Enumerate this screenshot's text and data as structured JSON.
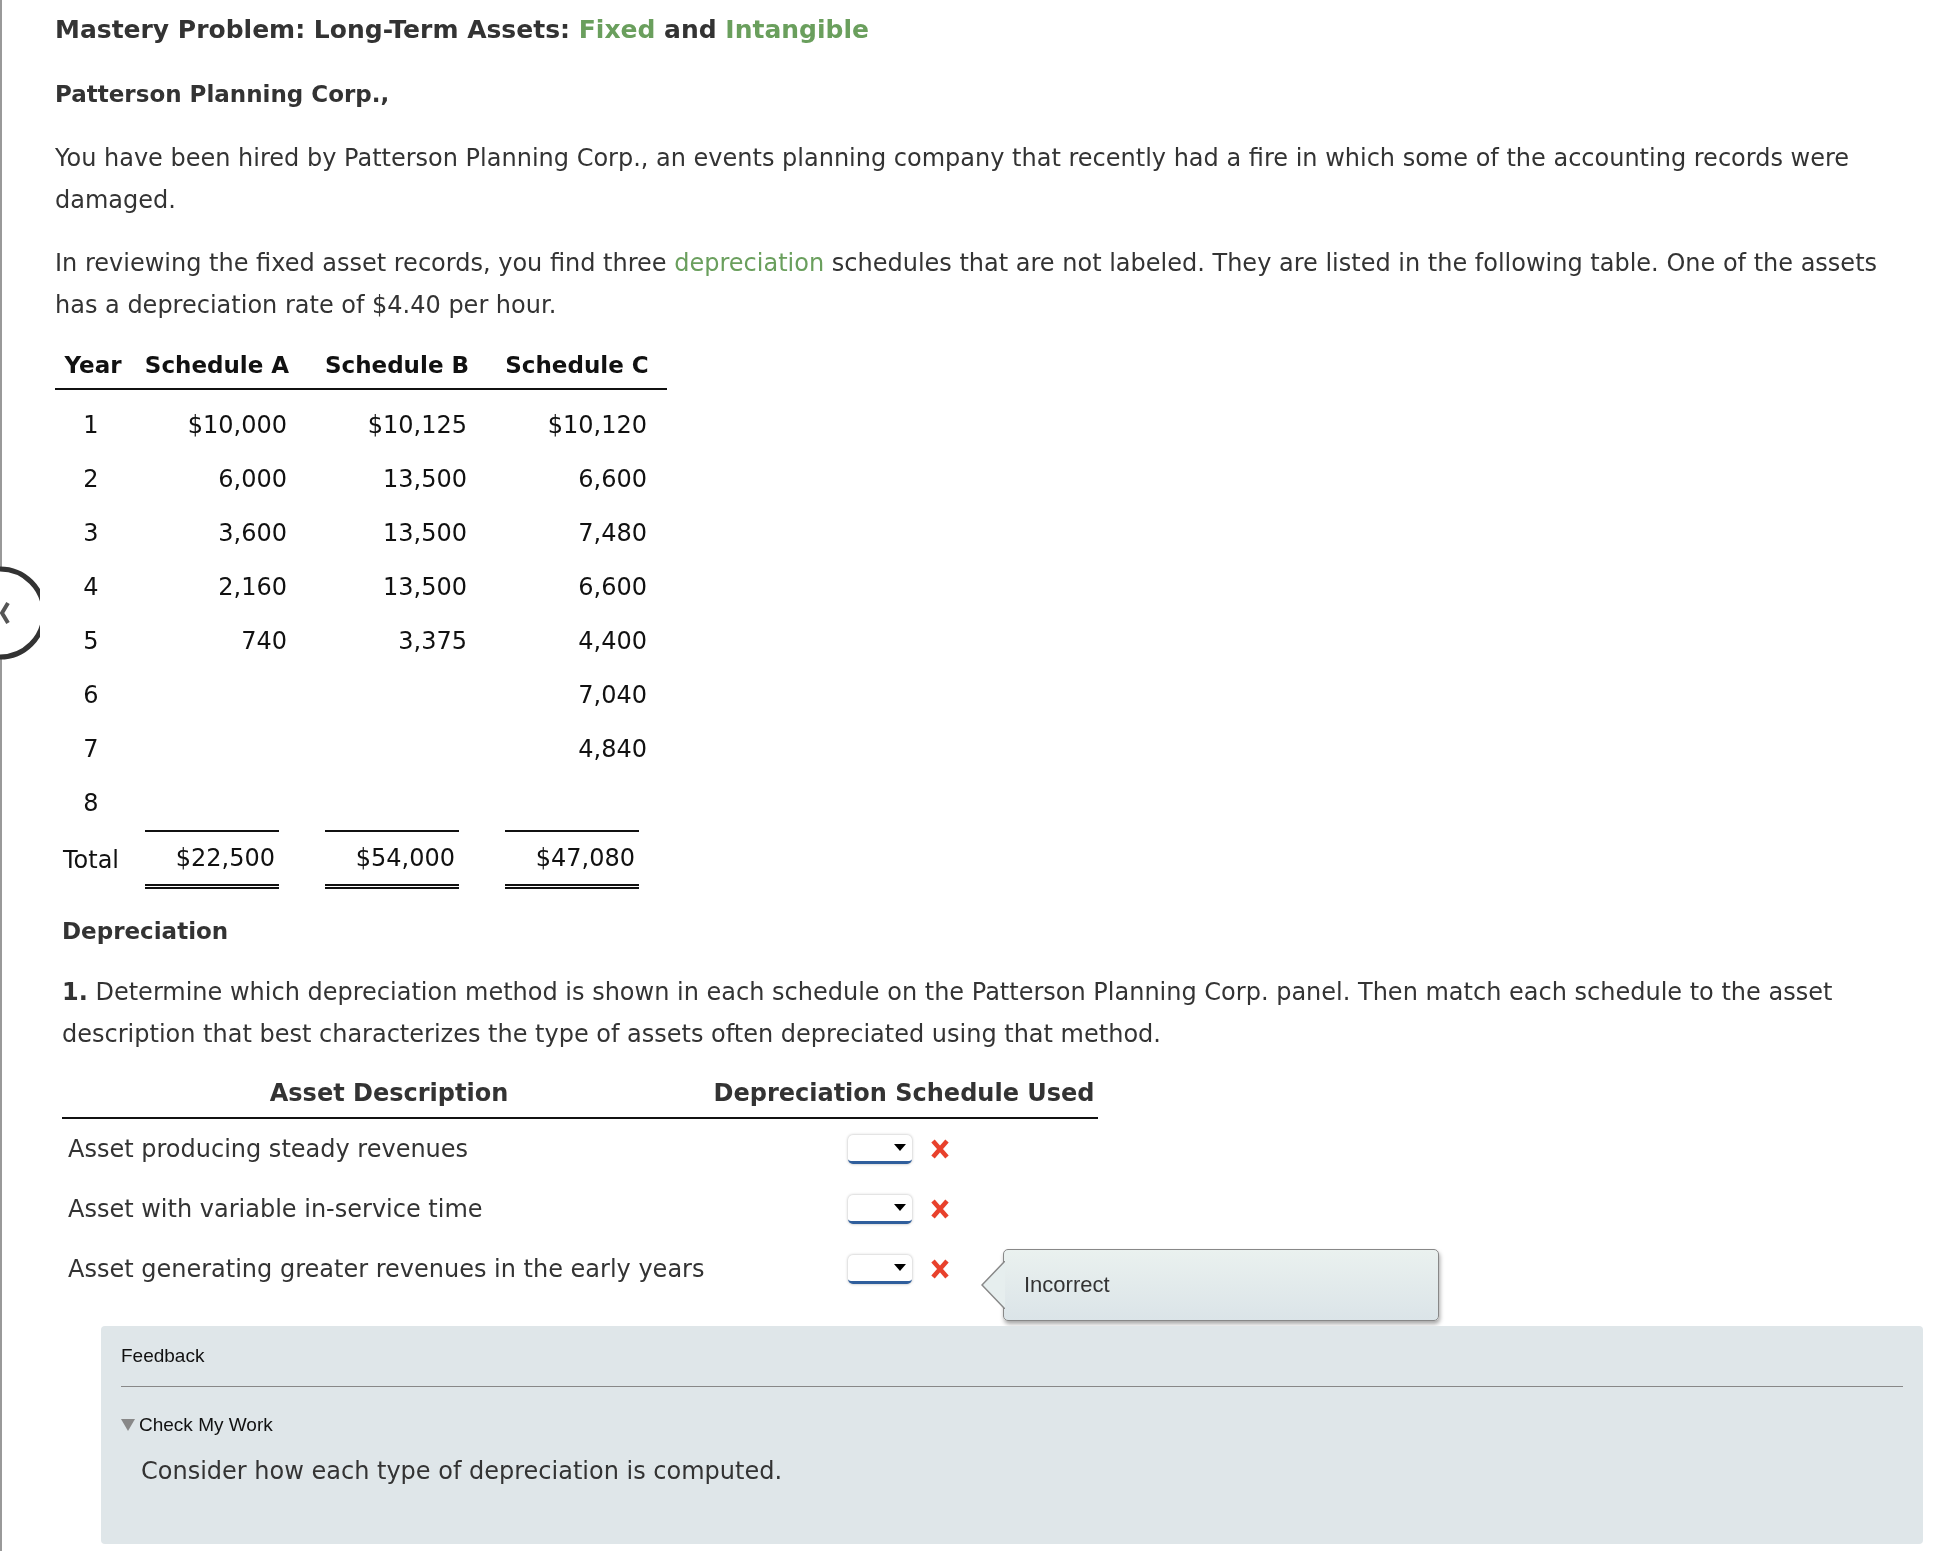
{
  "title": [
    {
      "kind": "plain",
      "text": "Mastery Problem: Long-Term Assets: "
    },
    {
      "kind": "link",
      "text": "Fixed"
    },
    {
      "kind": "plain",
      "text": " and "
    },
    {
      "kind": "link",
      "text": "Intangible"
    }
  ],
  "company": "Patterson Planning Corp.,",
  "paragraphs": [
    [
      {
        "kind": "plain",
        "text": "You have been hired by Patterson Planning Corp., an events planning company that recently had a fire in which some of the accounting records were damaged."
      }
    ],
    [
      {
        "kind": "plain",
        "text": "In reviewing the fixed asset records, you find three "
      },
      {
        "kind": "link",
        "text": "depreciation"
      },
      {
        "kind": "plain",
        "text": " schedules that are not labeled. They are listed in the following table. One of the assets has a depreciation rate of $4.40 per hour."
      }
    ]
  ],
  "schedule_table": {
    "columns": [
      "Year",
      "Schedule A",
      "Schedule B",
      "Schedule C"
    ],
    "rows": [
      {
        "year": "1",
        "schedule_a": "$10,000",
        "schedule_b": "$10,125",
        "schedule_c": "$10,120"
      },
      {
        "year": "2",
        "schedule_a": "6,000",
        "schedule_b": "13,500",
        "schedule_c": "6,600"
      },
      {
        "year": "3",
        "schedule_a": "3,600",
        "schedule_b": "13,500",
        "schedule_c": "7,480"
      },
      {
        "year": "4",
        "schedule_a": "2,160",
        "schedule_b": "13,500",
        "schedule_c": "6,600"
      },
      {
        "year": "5",
        "schedule_a": "740",
        "schedule_b": "3,375",
        "schedule_c": "4,400"
      },
      {
        "year": "6",
        "schedule_c": "7,040"
      },
      {
        "year": "7",
        "schedule_c": "4,840"
      },
      {
        "year": "8"
      }
    ],
    "total": {
      "label": "Total",
      "values": [
        "$22,500",
        "$54,000",
        "$47,080"
      ]
    }
  },
  "section_heading": "Depreciation",
  "question": "**1.** Determine which depreciation method is shown in each schedule on the Patterson Planning Corp. panel. Then match each schedule to the asset description that best characterizes the type of assets often depreciated using that method.",
  "matching": {
    "columns": [
      "Asset Description",
      "Depreciation Schedule Used"
    ],
    "rows": [
      {
        "description": "Asset producing steady revenues",
        "correct": false
      },
      {
        "description": "Asset with variable in-service time",
        "correct": false
      },
      {
        "description": "Asset generating greater revenues in the early years",
        "correct": false,
        "tooltip": "Incorrect"
      }
    ]
  },
  "feedback": {
    "title": "Feedback",
    "toggle": {
      "label": "Check My Work",
      "expanded": true
    },
    "text": "Consider how each type of depreciation is computed."
  }
}
